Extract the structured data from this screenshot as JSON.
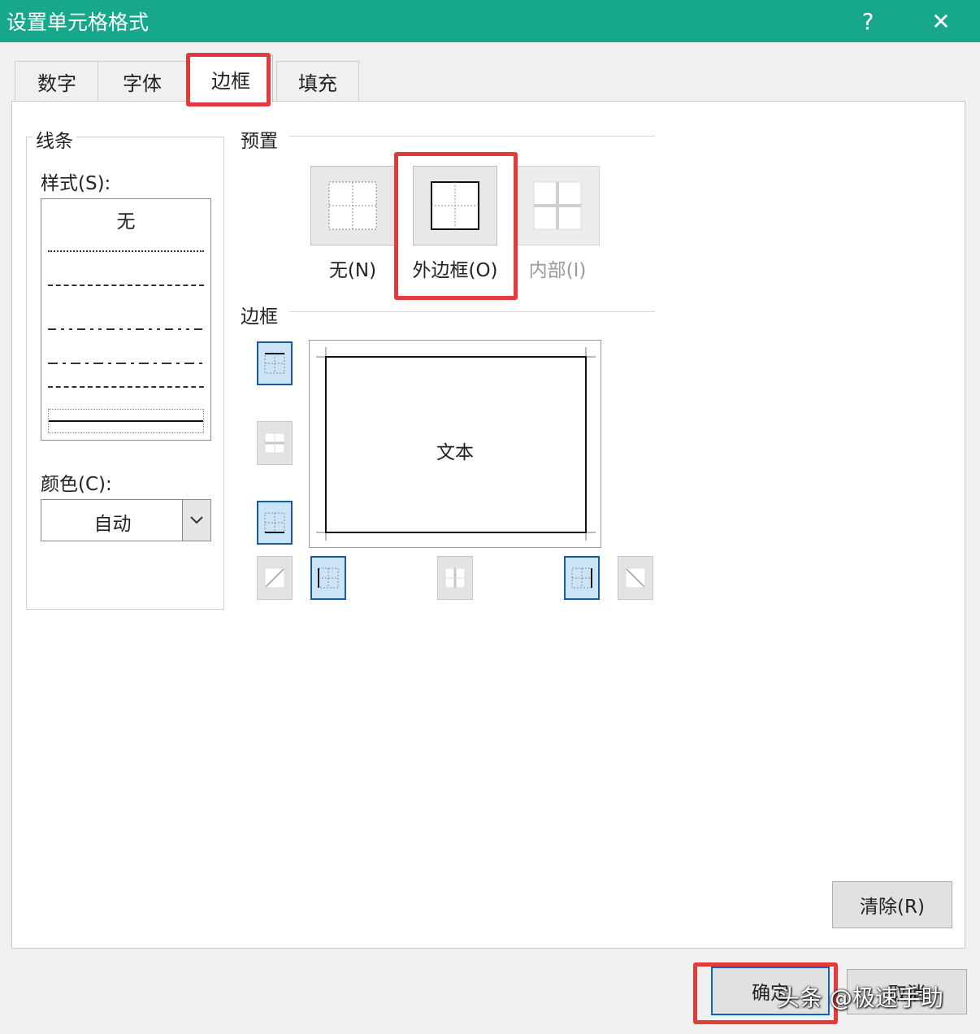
{
  "dialog": {
    "title": "设置单元格格式",
    "help_symbol": "?",
    "close_symbol": "✕"
  },
  "tabs": [
    {
      "label": "数字"
    },
    {
      "label": "字体"
    },
    {
      "label": "边框",
      "active": true
    },
    {
      "label": "填充"
    }
  ],
  "line": {
    "group_label": "线条",
    "style_label": "样式(S):",
    "style_none": "无",
    "color_label": "颜色(C):",
    "color_value": "自动"
  },
  "presets": {
    "group_label": "预置",
    "items": [
      {
        "label": "无(N)"
      },
      {
        "label": "外边框(O)",
        "selected": true
      },
      {
        "label": "内部(I)",
        "disabled": true
      }
    ]
  },
  "border": {
    "group_label": "边框",
    "preview_text": "文本"
  },
  "buttons": {
    "clear": "清除(R)",
    "ok": "确定",
    "cancel": "取消"
  },
  "watermark": "头条 @极速手助",
  "colors": {
    "titlebar": "#17a88c",
    "highlight": "#e23b3b",
    "selected_fill": "#cce4f7"
  }
}
